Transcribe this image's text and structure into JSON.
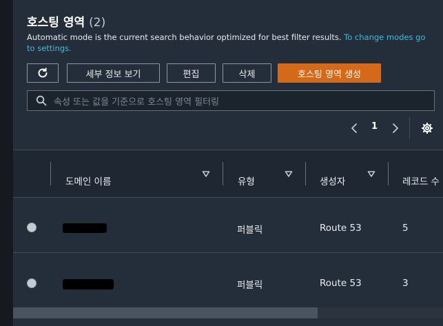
{
  "header": {
    "title": "호스팅 영역",
    "count": "(2)",
    "description": "Automatic mode is the current search behavior optimized for best filter results.",
    "description_link": "To change modes go to settings."
  },
  "toolbar": {
    "refresh_icon": "refresh-icon",
    "details_label": "세부 정보 보기",
    "edit_label": "편집",
    "delete_label": "삭제",
    "create_label": "호스팅 영역 생성"
  },
  "search": {
    "icon": "search-icon",
    "placeholder": "속성 또는 값을 기준으로 호스팅 영역 필터링"
  },
  "pagination": {
    "current_page": "1",
    "prev_icon": "chevron-left-icon",
    "next_icon": "chevron-right-icon",
    "settings_icon": "gear-icon"
  },
  "table": {
    "columns": [
      {
        "label": "도메인 이름"
      },
      {
        "label": "유형"
      },
      {
        "label": "생성자"
      },
      {
        "label": "레코드 수"
      }
    ],
    "rows": [
      {
        "domain": "",
        "type": "퍼블릭",
        "created_by": "Route 53",
        "record_count": "5"
      },
      {
        "domain": "",
        "type": "퍼블릭",
        "created_by": "Route 53",
        "record_count": "3"
      }
    ]
  },
  "colors": {
    "primary_button": "#d4691a",
    "link": "#44b9d6",
    "background": "#242e3a"
  }
}
